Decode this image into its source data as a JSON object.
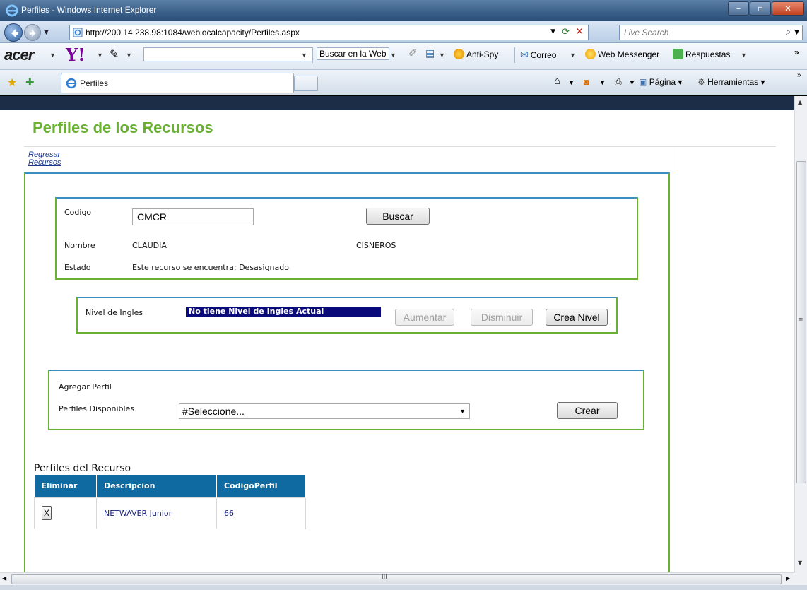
{
  "window": {
    "title": "Perfiles - Windows Internet Explorer"
  },
  "address": {
    "url": "http://200.14.238.98:1084/weblocalcapacity/Perfiles.aspx",
    "search_placeholder": "Live Search"
  },
  "toolbar": {
    "brand": "acer",
    "yahoo": "Y!",
    "search_web": "Buscar en la Web",
    "antispy": "Anti-Spy",
    "mail": "Correo",
    "messenger": "Web Messenger",
    "answers": "Respuestas",
    "more": "»"
  },
  "tabs": {
    "active_label": "Perfiles"
  },
  "commands": {
    "page": "Página",
    "tools": "Herramientas"
  },
  "page": {
    "title": "Perfiles de los Recursos",
    "back_link_line1": "Regresar",
    "back_link_line2": "Recursos",
    "codigo_label": "Codigo",
    "codigo_value": "CMCR",
    "buscar": "Buscar",
    "nombre_label": "Nombre",
    "nombre_value": "CLAUDIA",
    "apellido_value": "CISNEROS",
    "estado_label": "Estado",
    "estado_value": "Este recurso se encuentra: Desasignado",
    "nivel_label": "Nivel de Ingles",
    "nivel_value": "No tiene Nivel de Ingles Actual",
    "aumentar": "Aumentar",
    "disminuir": "Disminuir",
    "crea_nivel": "Crea Nivel",
    "agregar_perfil": "Agregar Perfil",
    "perfiles_disponibles_label": "Perfiles Disponibles",
    "perfiles_disponibles_selected": "#Seleccione...",
    "crear": "Crear",
    "perfiles_recurso_title": "Perfiles del Recurso",
    "grid": {
      "headers": [
        "Eliminar",
        "Descripcion",
        "CodigoPerfil"
      ],
      "rows": [
        {
          "eliminar": "X",
          "descripcion": "NETWAVER Junior",
          "codigo": "66"
        }
      ]
    }
  }
}
